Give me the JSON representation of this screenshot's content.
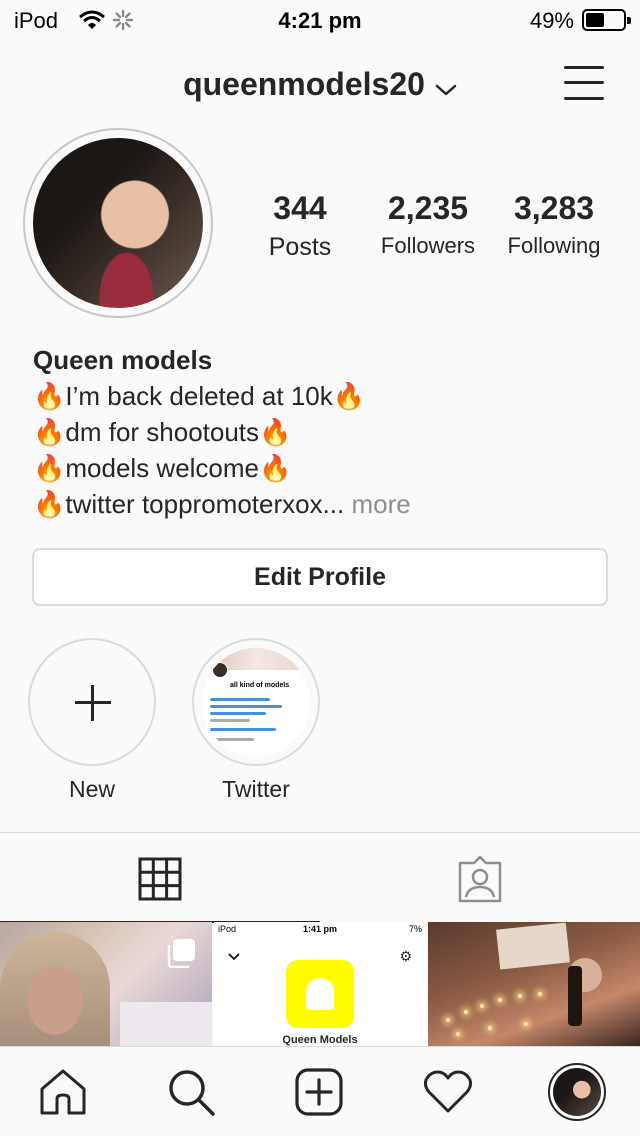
{
  "status_bar": {
    "carrier": "iPod",
    "time": "4:21 pm",
    "battery_percent": "49%",
    "battery_level": 0.49
  },
  "header": {
    "username": "queenmodels20",
    "icons": [
      "chevron-down-icon",
      "menu-icon"
    ]
  },
  "profile": {
    "stats": [
      {
        "value": "344",
        "label": "Posts"
      },
      {
        "value": "2,235",
        "label": "Followers"
      },
      {
        "value": "3,283",
        "label": "Following"
      }
    ],
    "bio": {
      "name": "Queen models",
      "lines": [
        "🔥I’m back deleted at 10k🔥",
        "🔥dm for shootouts🔥",
        "🔥models welcome🔥",
        "🔥twitter toppromoterxox..."
      ],
      "more_label": "more"
    },
    "edit_profile_label": "Edit Profile"
  },
  "highlights": [
    {
      "label": "New"
    },
    {
      "label": "Twitter",
      "thumb_text": "all kind of models"
    }
  ],
  "tabs": [
    {
      "name": "grid",
      "icon": "grid-icon",
      "active": true
    },
    {
      "name": "tagged",
      "icon": "tagged-icon",
      "active": false
    }
  ],
  "posts": [
    {
      "type": "photo",
      "multi": true
    },
    {
      "type": "screenshot",
      "mini_carrier": "iPod",
      "mini_time": "1:41 pm",
      "mini_battery": "7%",
      "caption": "Queen Models"
    },
    {
      "type": "photo",
      "multi": false
    }
  ],
  "bottom_nav": [
    {
      "icon": "home-icon"
    },
    {
      "icon": "search-icon"
    },
    {
      "icon": "add-post-icon"
    },
    {
      "icon": "heart-icon"
    },
    {
      "icon": "profile-avatar"
    }
  ]
}
